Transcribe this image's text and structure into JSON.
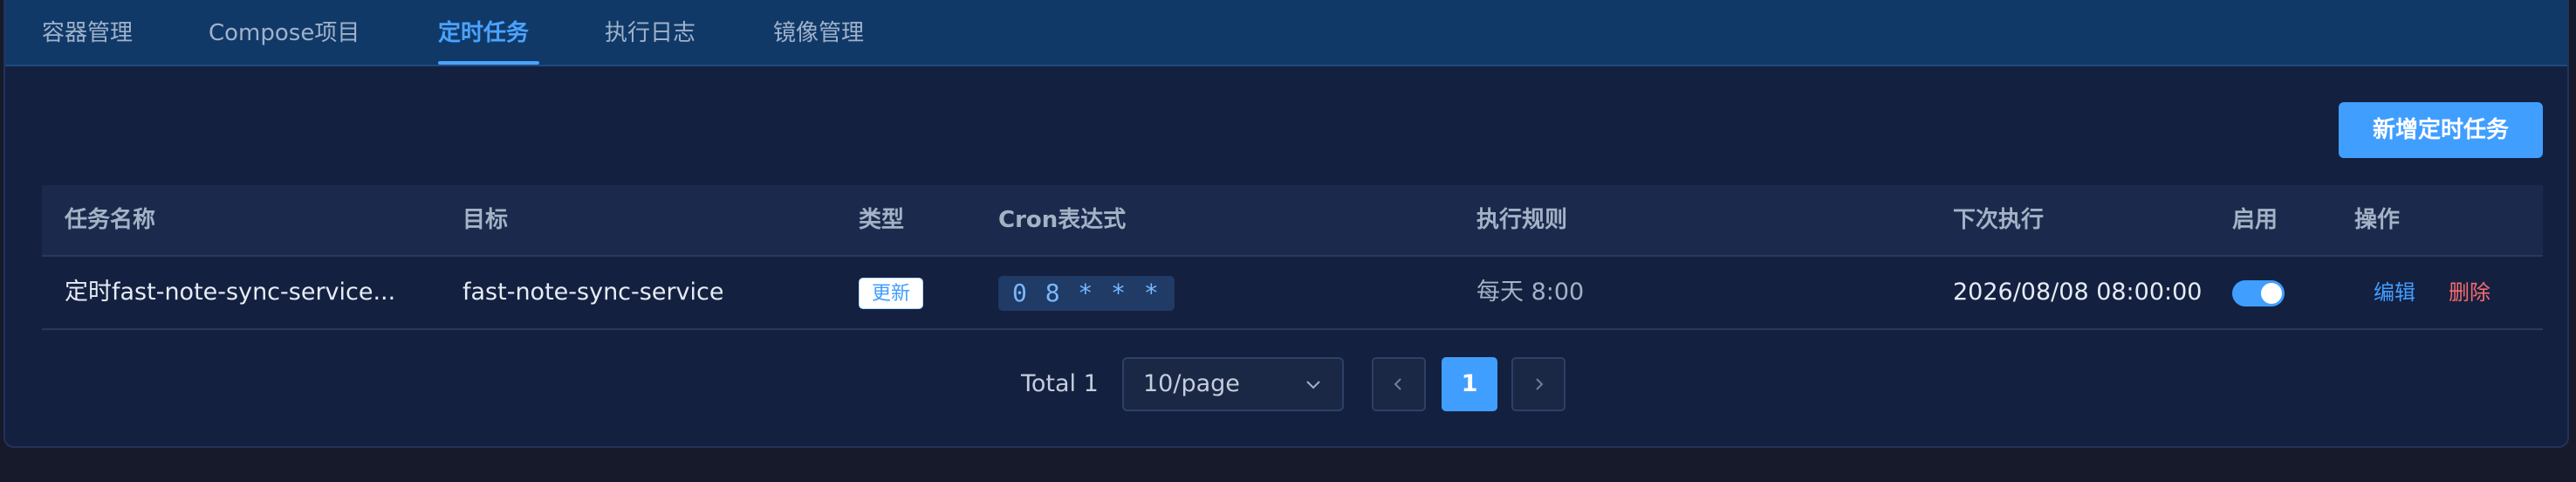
{
  "tabs": [
    {
      "label": "容器管理",
      "active": false
    },
    {
      "label": "Compose项目",
      "active": false
    },
    {
      "label": "定时任务",
      "active": true
    },
    {
      "label": "执行日志",
      "active": false
    },
    {
      "label": "镜像管理",
      "active": false
    }
  ],
  "toolbar": {
    "add_label": "新增定时任务"
  },
  "table": {
    "headers": {
      "name": "任务名称",
      "target": "目标",
      "type": "类型",
      "cron": "Cron表达式",
      "rule": "执行规则",
      "next": "下次执行",
      "enabled": "启用",
      "actions": "操作"
    },
    "rows": [
      {
        "name": "定时fast-note-sync-service...",
        "target": "fast-note-sync-service",
        "type": "更新",
        "cron": "0 8 * * *",
        "rule": "每天 8:00",
        "next": "2026/08/08 08:00:00",
        "enabled": true,
        "edit": "编辑",
        "delete": "删除"
      }
    ]
  },
  "pagination": {
    "total": "Total 1",
    "page_size": "10/page",
    "current_page": "1"
  },
  "colors": {
    "accent": "#409eff",
    "danger": "#f56c6c",
    "background": "#142040"
  },
  "icons": {
    "dropdown": "chevron-down-icon",
    "prev": "chevron-left-icon",
    "next": "chevron-right-icon"
  }
}
